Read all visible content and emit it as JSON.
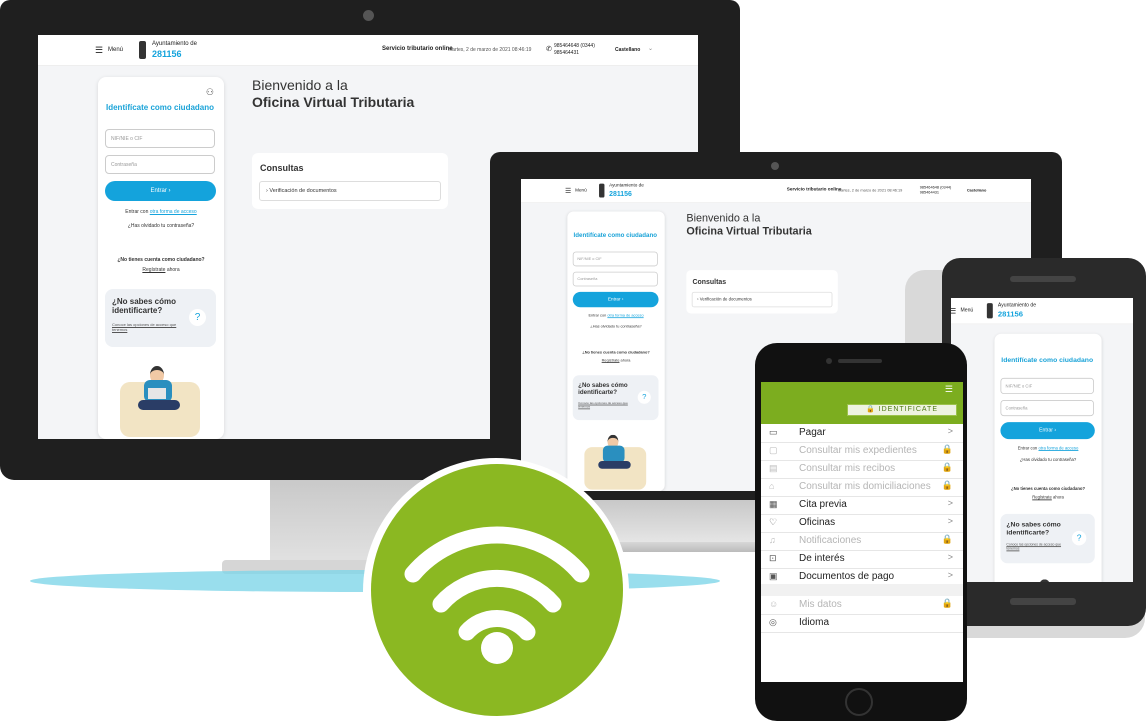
{
  "desktop": {
    "header": {
      "menu_label": "Menú",
      "org_name": "Ayuntamiento de",
      "org_code": "281156",
      "service": "Servicio tributario online",
      "datetime": "Martes, 2 de marzo de 2021 08:46:19",
      "phone1": "985464648 (0344)",
      "phone2": "985464431",
      "language": "Castellano"
    },
    "sidebar": {
      "ident_title": "Identifícate como ciudadano",
      "nif_placeholder": "NIF/NIE o CIF",
      "password_placeholder": "Contraseña",
      "enter_label": "Entrar",
      "alt_access_prefix": "Entrar con",
      "alt_access_link": "otra forma de acceso",
      "forgot": "¿Has olvidado tu contraseña?",
      "no_account": "¿No tienes cuenta como ciudadano?",
      "register_link": "Regístrate",
      "register_suffix": "ahora",
      "help_title": "¿No sabes cómo identificarte?",
      "help_link": "Conoce las opciones de acceso que tenemos",
      "help_icon": "?"
    },
    "main": {
      "welcome_line1": "Bienvenido a la",
      "welcome_line2": "Oficina Virtual Tributaria",
      "consultas_title": "Consultas",
      "consultas_item": "Verificación de documentos"
    }
  },
  "phone": {
    "identify_button": "IDENTIFICATE",
    "menu": [
      {
        "label": "Pagar",
        "icon": "card-icon",
        "end": ">",
        "disabled": false
      },
      {
        "label": "Consultar mis expedientes",
        "icon": "folder-icon",
        "end": "lock",
        "disabled": true
      },
      {
        "label": "Consultar mis recibos",
        "icon": "receipt-icon",
        "end": "lock",
        "disabled": true
      },
      {
        "label": "Consultar mis domiciliaciones",
        "icon": "bank-icon",
        "end": "lock",
        "disabled": true
      },
      {
        "label": "Cita previa",
        "icon": "calendar-icon",
        "end": ">",
        "disabled": false
      },
      {
        "label": "Oficinas",
        "icon": "location-icon",
        "end": ">",
        "disabled": false
      },
      {
        "label": "Notificaciones",
        "icon": "bell-icon",
        "end": "lock",
        "disabled": true
      },
      {
        "label": "De interés",
        "icon": "info-icon",
        "end": ">",
        "disabled": false
      },
      {
        "label": "Documentos de pago",
        "icon": "document-icon",
        "end": ">",
        "disabled": false
      }
    ],
    "menu2": [
      {
        "label": "Mis datos",
        "icon": "user-icon",
        "end": "lock",
        "disabled": true
      },
      {
        "label": "Idioma",
        "icon": "globe-icon",
        "end": "",
        "disabled": false
      }
    ]
  },
  "colors": {
    "accent_blue": "#14a3dc",
    "green": "#7cad1f",
    "wifi_green": "#8bb822",
    "device_dark": "#1f1f1f"
  }
}
